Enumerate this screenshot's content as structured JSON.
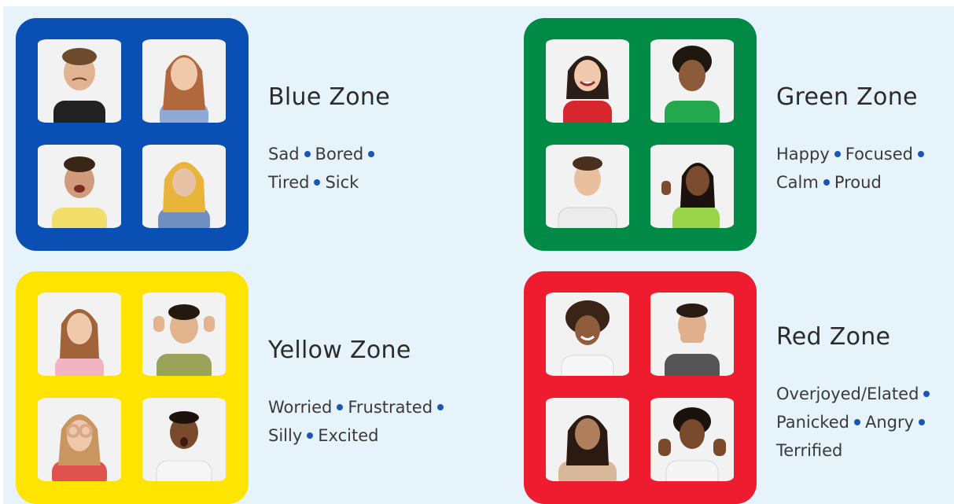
{
  "zones": [
    {
      "id": "blue",
      "title": "Blue Zone",
      "color": "#0a4fb3",
      "lines": [
        [
          "Sad",
          "Bored",
          ""
        ],
        [
          "Tired",
          "Sick"
        ]
      ],
      "photos": [
        "crying-boy",
        "tired-girl",
        "yawning-boy",
        "sick-girl-hijab"
      ]
    },
    {
      "id": "green",
      "title": "Green Zone",
      "color": "#018a45",
      "lines": [
        [
          "Happy",
          "Focused",
          ""
        ],
        [
          "Calm",
          "Proud"
        ]
      ],
      "photos": [
        "smiling-girl",
        "calm-boy",
        "focused-teen",
        "thumbs-up-girl"
      ]
    },
    {
      "id": "yellow",
      "title": "Yellow Zone",
      "color": "#ffe400",
      "lines": [
        [
          "Worried",
          "Frustrated",
          ""
        ],
        [
          "Silly",
          "Excited"
        ]
      ],
      "photos": [
        "worried-girl",
        "frustrated-boy",
        "silly-girl",
        "excited-boy"
      ]
    },
    {
      "id": "red",
      "title": "Red Zone",
      "color": "#ee1c2e",
      "lines": [
        [
          "Overjoyed/Elated",
          ""
        ],
        [
          "Panicked",
          "Angry",
          ""
        ],
        [
          "Terrified"
        ]
      ],
      "photos": [
        "overjoyed-girl",
        "panicked-boy",
        "angry-girl",
        "terrified-boy"
      ]
    }
  ],
  "separator_color": "#1a56b8"
}
